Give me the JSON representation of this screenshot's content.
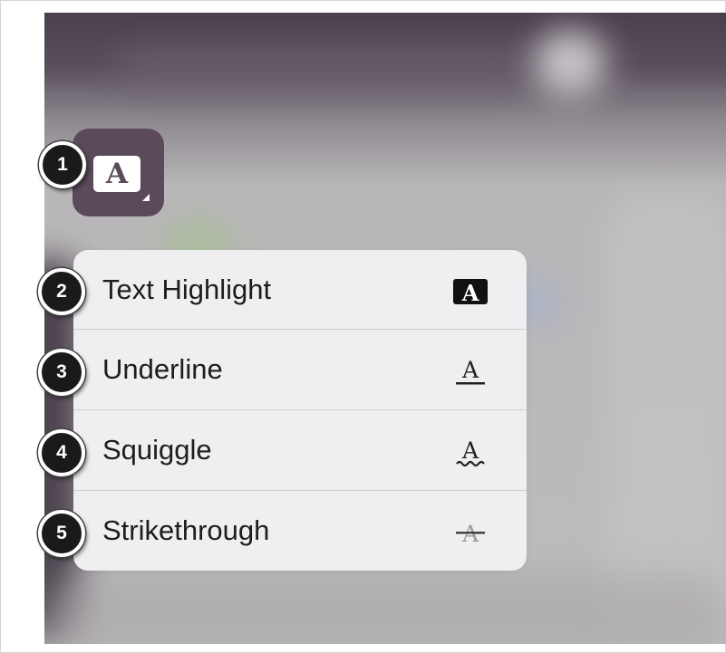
{
  "toolbar": {
    "annotation_tool": {
      "glyph": "A",
      "icon": "text-annotation-icon",
      "color": "#5a4a5a"
    }
  },
  "menu": {
    "items": [
      {
        "label": "Text Highlight",
        "icon": "text-highlight-icon"
      },
      {
        "label": "Underline",
        "icon": "underline-icon"
      },
      {
        "label": "Squiggle",
        "icon": "squiggle-icon"
      },
      {
        "label": "Strikethrough",
        "icon": "strikethrough-icon"
      }
    ],
    "icon_glyph": "A"
  },
  "callouts": [
    "1",
    "2",
    "3",
    "4",
    "5"
  ]
}
